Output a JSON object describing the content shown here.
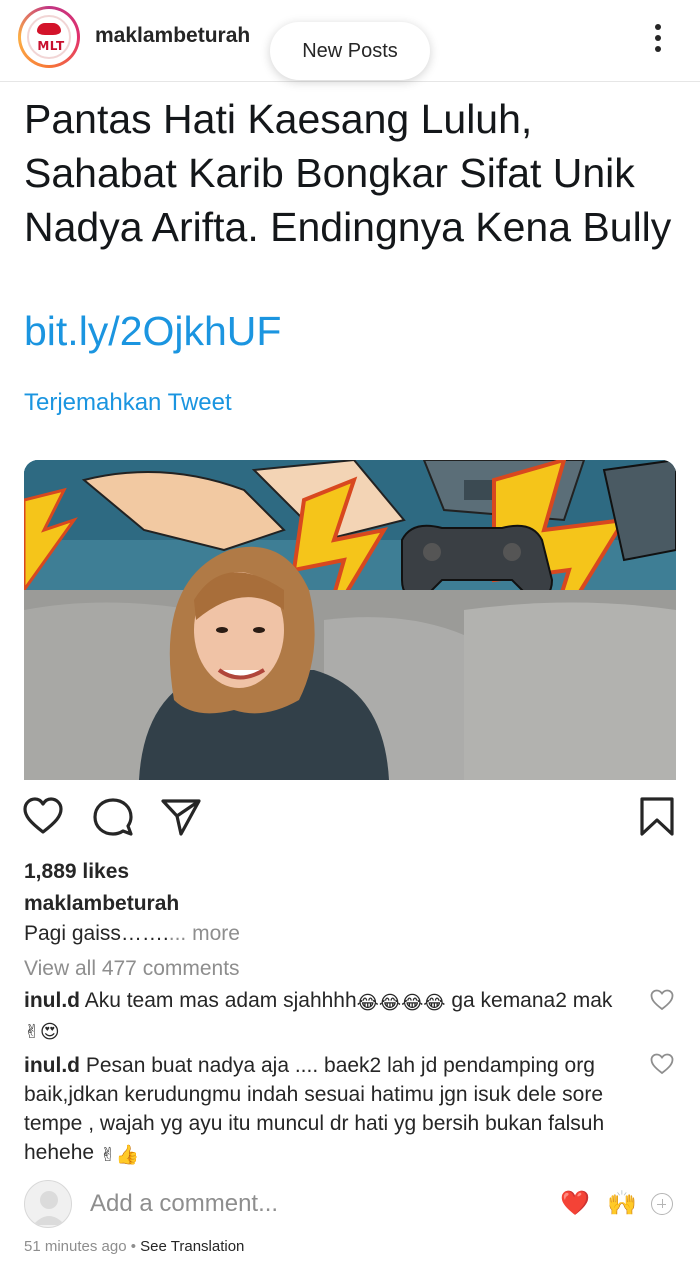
{
  "header": {
    "logo_text": "MLT",
    "username": "maklambeturah",
    "new_posts_label": "New Posts"
  },
  "tweet": {
    "text": "Pantas Hati Kaesang Luluh, Sahabat Karib Bongkar Sifat Unik Nadya Arifta. Endingnya Kena Bully",
    "link": "bit.ly/2OjkhUF",
    "translate_label": "Terjemahkan Tweet"
  },
  "post": {
    "likes": "1,889 likes",
    "caption_user": "maklambeturah",
    "caption_text": "Pagi gaiss…….",
    "caption_more": "... more",
    "view_all_comments": "View all 477 comments"
  },
  "comments": [
    {
      "user": "inul.d",
      "text": "Aku team mas adam sjahhhh",
      "emoji_a": "😂😂😂😂",
      "text_b": " ga kemana2 mak ",
      "emoji_b": "✌😍"
    },
    {
      "user": "inul.d",
      "text": "Pesan buat nadya aja .... baek2 lah jd pendamping org baik,jdkan kerudungmu indah sesuai hatimu jgn isuk dele sore tempe , wajah yg ayu itu muncul dr hati yg bersih bukan falsuh hehehe ",
      "emoji_a": "✌👍"
    }
  ],
  "add_comment": {
    "placeholder": "Add a comment...",
    "quick_reactions": [
      "❤️",
      "🙌"
    ]
  },
  "footer": {
    "time": "51 minutes ago",
    "separator": " • ",
    "see_translation": "See Translation"
  },
  "icons": {
    "header": [
      "avatar-logo",
      "more-options-icon"
    ],
    "actions": [
      "heart-icon",
      "comment-icon",
      "share-icon",
      "bookmark-icon"
    ]
  },
  "colors": {
    "link_blue": "#1b95e0",
    "secondary_text": "#8e8e8e",
    "heart_red": "#e0243b"
  }
}
